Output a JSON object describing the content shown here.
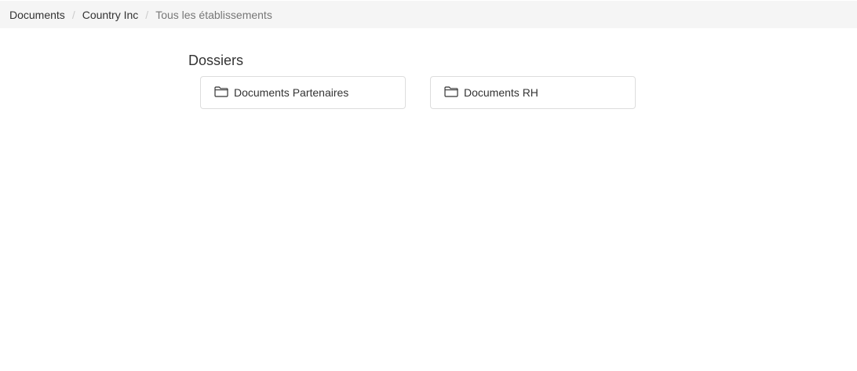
{
  "breadcrumb": {
    "items": [
      {
        "label": "Documents"
      },
      {
        "label": "Country Inc"
      },
      {
        "label": "Tous les établissements"
      }
    ],
    "separator": "/"
  },
  "folders": {
    "title": "Dossiers",
    "items": [
      {
        "label": "Documents Partenaires",
        "icon": "folder-icon"
      },
      {
        "label": "Documents RH",
        "icon": "folder-icon"
      }
    ]
  },
  "colors": {
    "breadcrumb_bg": "#f5f5f5",
    "card_border": "#dddddd",
    "text": "#333333",
    "muted": "#777777"
  }
}
